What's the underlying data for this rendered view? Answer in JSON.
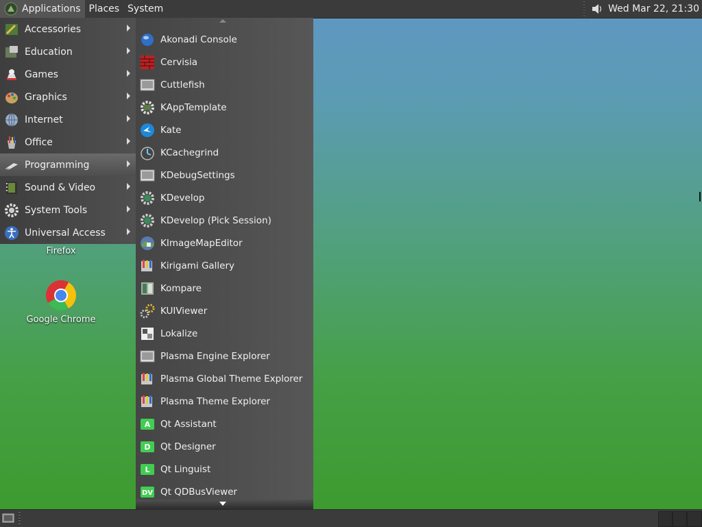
{
  "top_panel": {
    "menus": [
      "Applications",
      "Places",
      "System"
    ],
    "clock": "Wed Mar 22, 21:30",
    "volume_icon": "speaker-icon"
  },
  "categories": [
    {
      "label": "Accessories",
      "icon": "accessories-icon"
    },
    {
      "label": "Education",
      "icon": "education-icon"
    },
    {
      "label": "Games",
      "icon": "games-icon"
    },
    {
      "label": "Graphics",
      "icon": "graphics-icon"
    },
    {
      "label": "Internet",
      "icon": "internet-icon"
    },
    {
      "label": "Office",
      "icon": "office-icon"
    },
    {
      "label": "Programming",
      "icon": "programming-icon",
      "selected": true
    },
    {
      "label": "Sound & Video",
      "icon": "sound-video-icon"
    },
    {
      "label": "System Tools",
      "icon": "system-tools-icon"
    },
    {
      "label": "Universal Access",
      "icon": "universal-access-icon"
    }
  ],
  "programming_items": [
    {
      "label": "Akonadi Console",
      "icon": "akonadi-console-icon"
    },
    {
      "label": "Cervisia",
      "icon": "cervisia-icon"
    },
    {
      "label": "Cuttlefish",
      "icon": "cuttlefish-icon"
    },
    {
      "label": "KAppTemplate",
      "icon": "kapptemplate-icon"
    },
    {
      "label": "Kate",
      "icon": "kate-icon"
    },
    {
      "label": "KCachegrind",
      "icon": "kcachegrind-icon"
    },
    {
      "label": "KDebugSettings",
      "icon": "kdebugsettings-icon"
    },
    {
      "label": "KDevelop",
      "icon": "kdevelop-icon"
    },
    {
      "label": "KDevelop (Pick Session)",
      "icon": "kdevelop-icon"
    },
    {
      "label": "KImageMapEditor",
      "icon": "kimagemapeditor-icon"
    },
    {
      "label": "Kirigami Gallery",
      "icon": "kirigami-gallery-icon"
    },
    {
      "label": "Kompare",
      "icon": "kompare-icon"
    },
    {
      "label": "KUIViewer",
      "icon": "kuiviewer-icon"
    },
    {
      "label": "Lokalize",
      "icon": "lokalize-icon"
    },
    {
      "label": "Plasma Engine Explorer",
      "icon": "plasma-engine-explorer-icon"
    },
    {
      "label": "Plasma Global Theme Explorer",
      "icon": "plasma-global-theme-explorer-icon"
    },
    {
      "label": "Plasma Theme Explorer",
      "icon": "plasma-theme-explorer-icon"
    },
    {
      "label": "Qt Assistant",
      "icon": "qt-assistant-icon",
      "letter": "A"
    },
    {
      "label": "Qt Designer",
      "icon": "qt-designer-icon",
      "letter": "D"
    },
    {
      "label": "Qt Linguist",
      "icon": "qt-linguist-icon",
      "letter": "L"
    },
    {
      "label": "Qt QDBusViewer",
      "icon": "qt-qdbusviewer-icon",
      "letter": "DV"
    }
  ],
  "desktop_icons": [
    {
      "label": "Firefox"
    },
    {
      "label": "Google Chrome"
    }
  ],
  "colors": {
    "panel": "#3b3b3b",
    "menu_bg": "#4a4a4a",
    "selected": "#5e5e5e",
    "qt_green": "#41cd52",
    "desktop_top": "#5f97c4",
    "desktop_bottom": "#3c9a2c"
  }
}
